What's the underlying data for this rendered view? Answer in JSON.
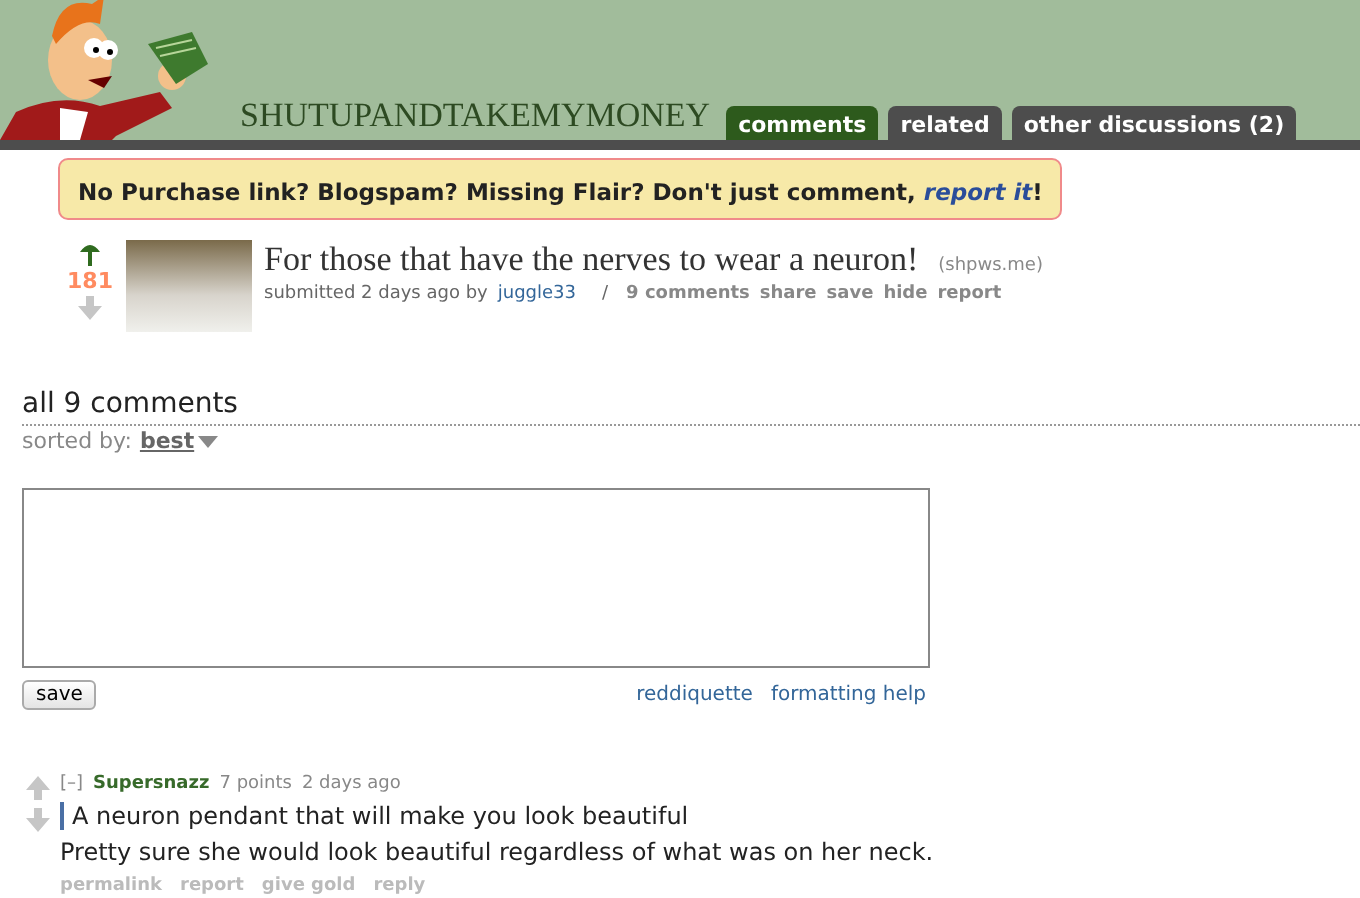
{
  "header": {
    "subreddit": "SHUTUPANDTAKEMYMONEY",
    "tabs": [
      {
        "label": "comments",
        "selected": true
      },
      {
        "label": "related",
        "selected": false
      },
      {
        "label": "other discussions (2)",
        "selected": false
      }
    ]
  },
  "notice": {
    "text": "No Purchase link? Blogspam? Missing Flair? Don't just comment, ",
    "link": "report it",
    "end": "!"
  },
  "post": {
    "score": "181",
    "upvoted": true,
    "title": "For those that have the nerves to wear a neuron!",
    "domain": "(shpws.me)",
    "submitted": "submitted 2 days ago by",
    "author": "juggle33",
    "separator": "/",
    "actions": [
      "9 comments",
      "share",
      "save",
      "hide",
      "report"
    ]
  },
  "comments_header": {
    "title": "all 9 comments",
    "sort_label": "sorted by:",
    "sort_value": "best"
  },
  "reply_form": {
    "save": "save",
    "links": [
      "reddiquette",
      "formatting help"
    ]
  },
  "comments": [
    {
      "toggle": "[–]",
      "author": "Supersnazz",
      "points": "7 points",
      "time": "2 days ago",
      "quote": "A neuron pendant that will make you look beautiful",
      "body": "Pretty sure she would look beautiful regardless of what was on her neck.",
      "actions": [
        "permalink",
        "report",
        "give gold",
        "reply"
      ]
    }
  ]
}
